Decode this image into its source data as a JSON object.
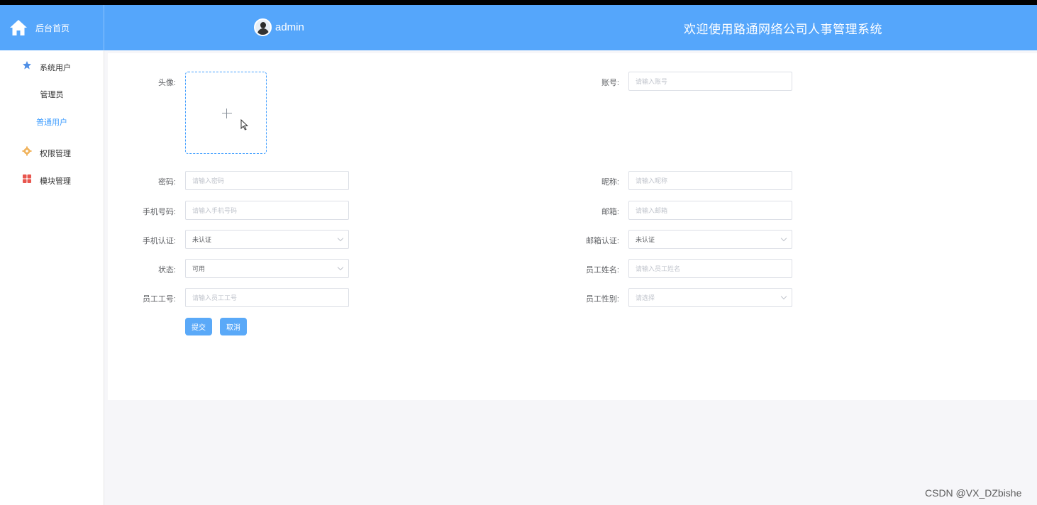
{
  "header": {
    "home_label": "后台首页",
    "username": "admin",
    "system_title": "欢迎使用路通网络公司人事管理系统"
  },
  "sidebar": {
    "items": [
      {
        "label": "系统用户",
        "icon": "star-icon"
      },
      {
        "label": "管理员"
      },
      {
        "label": "普通用户"
      },
      {
        "label": "权限管理",
        "icon": "gear-icon"
      },
      {
        "label": "模块管理",
        "icon": "grid-icon"
      }
    ]
  },
  "form": {
    "avatar_label": "头像:",
    "account_label": "账号:",
    "account_placeholder": "请输入账号",
    "password_label": "密码:",
    "password_placeholder": "请输入密码",
    "nickname_label": "昵称:",
    "nickname_placeholder": "请输入昵称",
    "phone_label": "手机号码:",
    "phone_placeholder": "请输入手机号码",
    "email_label": "邮箱:",
    "email_placeholder": "请输入邮箱",
    "phone_verify_label": "手机认证:",
    "phone_verify_value": "未认证",
    "email_verify_label": "邮箱认证:",
    "email_verify_value": "未认证",
    "status_label": "状态:",
    "status_value": "可用",
    "emp_name_label": "员工姓名:",
    "emp_name_placeholder": "请输入员工姓名",
    "emp_no_label": "员工工号:",
    "emp_no_placeholder": "请输入员工工号",
    "emp_gender_label": "员工性别:",
    "emp_gender_placeholder": "请选择",
    "submit_label": "提交",
    "cancel_label": "取消"
  },
  "watermark": "CSDN @VX_DZbishe",
  "colors": {
    "header_bg": "#55a6fb",
    "primary": "#409eff",
    "active_menu": "#409eff"
  }
}
